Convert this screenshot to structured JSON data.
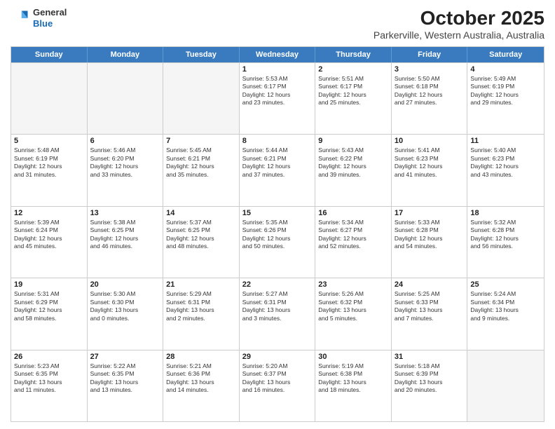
{
  "header": {
    "logo_line1": "General",
    "logo_line2": "Blue",
    "title": "October 2025",
    "subtitle": "Parkerville, Western Australia, Australia"
  },
  "days_of_week": [
    "Sunday",
    "Monday",
    "Tuesday",
    "Wednesday",
    "Thursday",
    "Friday",
    "Saturday"
  ],
  "weeks": [
    [
      {
        "day": "",
        "info": ""
      },
      {
        "day": "",
        "info": ""
      },
      {
        "day": "",
        "info": ""
      },
      {
        "day": "1",
        "info": "Sunrise: 5:53 AM\nSunset: 6:17 PM\nDaylight: 12 hours\nand 23 minutes."
      },
      {
        "day": "2",
        "info": "Sunrise: 5:51 AM\nSunset: 6:17 PM\nDaylight: 12 hours\nand 25 minutes."
      },
      {
        "day": "3",
        "info": "Sunrise: 5:50 AM\nSunset: 6:18 PM\nDaylight: 12 hours\nand 27 minutes."
      },
      {
        "day": "4",
        "info": "Sunrise: 5:49 AM\nSunset: 6:19 PM\nDaylight: 12 hours\nand 29 minutes."
      }
    ],
    [
      {
        "day": "5",
        "info": "Sunrise: 5:48 AM\nSunset: 6:19 PM\nDaylight: 12 hours\nand 31 minutes."
      },
      {
        "day": "6",
        "info": "Sunrise: 5:46 AM\nSunset: 6:20 PM\nDaylight: 12 hours\nand 33 minutes."
      },
      {
        "day": "7",
        "info": "Sunrise: 5:45 AM\nSunset: 6:21 PM\nDaylight: 12 hours\nand 35 minutes."
      },
      {
        "day": "8",
        "info": "Sunrise: 5:44 AM\nSunset: 6:21 PM\nDaylight: 12 hours\nand 37 minutes."
      },
      {
        "day": "9",
        "info": "Sunrise: 5:43 AM\nSunset: 6:22 PM\nDaylight: 12 hours\nand 39 minutes."
      },
      {
        "day": "10",
        "info": "Sunrise: 5:41 AM\nSunset: 6:23 PM\nDaylight: 12 hours\nand 41 minutes."
      },
      {
        "day": "11",
        "info": "Sunrise: 5:40 AM\nSunset: 6:23 PM\nDaylight: 12 hours\nand 43 minutes."
      }
    ],
    [
      {
        "day": "12",
        "info": "Sunrise: 5:39 AM\nSunset: 6:24 PM\nDaylight: 12 hours\nand 45 minutes."
      },
      {
        "day": "13",
        "info": "Sunrise: 5:38 AM\nSunset: 6:25 PM\nDaylight: 12 hours\nand 46 minutes."
      },
      {
        "day": "14",
        "info": "Sunrise: 5:37 AM\nSunset: 6:25 PM\nDaylight: 12 hours\nand 48 minutes."
      },
      {
        "day": "15",
        "info": "Sunrise: 5:35 AM\nSunset: 6:26 PM\nDaylight: 12 hours\nand 50 minutes."
      },
      {
        "day": "16",
        "info": "Sunrise: 5:34 AM\nSunset: 6:27 PM\nDaylight: 12 hours\nand 52 minutes."
      },
      {
        "day": "17",
        "info": "Sunrise: 5:33 AM\nSunset: 6:28 PM\nDaylight: 12 hours\nand 54 minutes."
      },
      {
        "day": "18",
        "info": "Sunrise: 5:32 AM\nSunset: 6:28 PM\nDaylight: 12 hours\nand 56 minutes."
      }
    ],
    [
      {
        "day": "19",
        "info": "Sunrise: 5:31 AM\nSunset: 6:29 PM\nDaylight: 12 hours\nand 58 minutes."
      },
      {
        "day": "20",
        "info": "Sunrise: 5:30 AM\nSunset: 6:30 PM\nDaylight: 13 hours\nand 0 minutes."
      },
      {
        "day": "21",
        "info": "Sunrise: 5:29 AM\nSunset: 6:31 PM\nDaylight: 13 hours\nand 2 minutes."
      },
      {
        "day": "22",
        "info": "Sunrise: 5:27 AM\nSunset: 6:31 PM\nDaylight: 13 hours\nand 3 minutes."
      },
      {
        "day": "23",
        "info": "Sunrise: 5:26 AM\nSunset: 6:32 PM\nDaylight: 13 hours\nand 5 minutes."
      },
      {
        "day": "24",
        "info": "Sunrise: 5:25 AM\nSunset: 6:33 PM\nDaylight: 13 hours\nand 7 minutes."
      },
      {
        "day": "25",
        "info": "Sunrise: 5:24 AM\nSunset: 6:34 PM\nDaylight: 13 hours\nand 9 minutes."
      }
    ],
    [
      {
        "day": "26",
        "info": "Sunrise: 5:23 AM\nSunset: 6:35 PM\nDaylight: 13 hours\nand 11 minutes."
      },
      {
        "day": "27",
        "info": "Sunrise: 5:22 AM\nSunset: 6:35 PM\nDaylight: 13 hours\nand 13 minutes."
      },
      {
        "day": "28",
        "info": "Sunrise: 5:21 AM\nSunset: 6:36 PM\nDaylight: 13 hours\nand 14 minutes."
      },
      {
        "day": "29",
        "info": "Sunrise: 5:20 AM\nSunset: 6:37 PM\nDaylight: 13 hours\nand 16 minutes."
      },
      {
        "day": "30",
        "info": "Sunrise: 5:19 AM\nSunset: 6:38 PM\nDaylight: 13 hours\nand 18 minutes."
      },
      {
        "day": "31",
        "info": "Sunrise: 5:18 AM\nSunset: 6:39 PM\nDaylight: 13 hours\nand 20 minutes."
      },
      {
        "day": "",
        "info": ""
      }
    ]
  ]
}
